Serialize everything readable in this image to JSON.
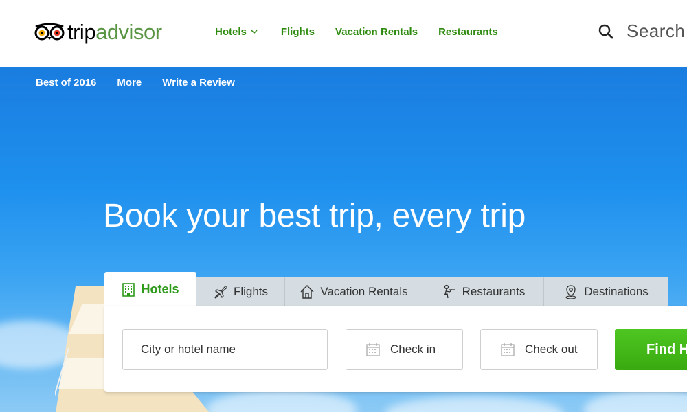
{
  "header": {
    "logo": {
      "part1": "trip",
      "part2": "advisor",
      "icon": "owl-eyes-icon"
    },
    "nav": [
      {
        "label": "Hotels",
        "has_dropdown": true
      },
      {
        "label": "Flights"
      },
      {
        "label": "Vacation Rentals"
      },
      {
        "label": "Restaurants"
      }
    ],
    "search": {
      "label": "Search",
      "icon": "search-icon"
    }
  },
  "subnav": [
    "Best of 2016",
    "More",
    "Write a Review"
  ],
  "hero": {
    "headline": "Book your best trip, every trip"
  },
  "booking": {
    "tabs": [
      {
        "label": "Hotels",
        "icon": "hotel-building-icon",
        "active": true
      },
      {
        "label": "Flights",
        "icon": "airplane-icon"
      },
      {
        "label": "Vacation Rentals",
        "icon": "house-icon"
      },
      {
        "label": "Restaurants",
        "icon": "restaurant-waiter-icon"
      },
      {
        "label": "Destinations",
        "icon": "map-pin-icon"
      }
    ],
    "city_placeholder": "City or hotel name",
    "checkin_placeholder": "Check in",
    "checkout_placeholder": "Check out",
    "find_button": "Find H"
  },
  "colors": {
    "brand_green": "#2e8b0f",
    "logo_green": "#589442",
    "sky_blue": "#1e90ee",
    "button_green": "#39aa10",
    "tab_inactive": "#d5dde2"
  }
}
